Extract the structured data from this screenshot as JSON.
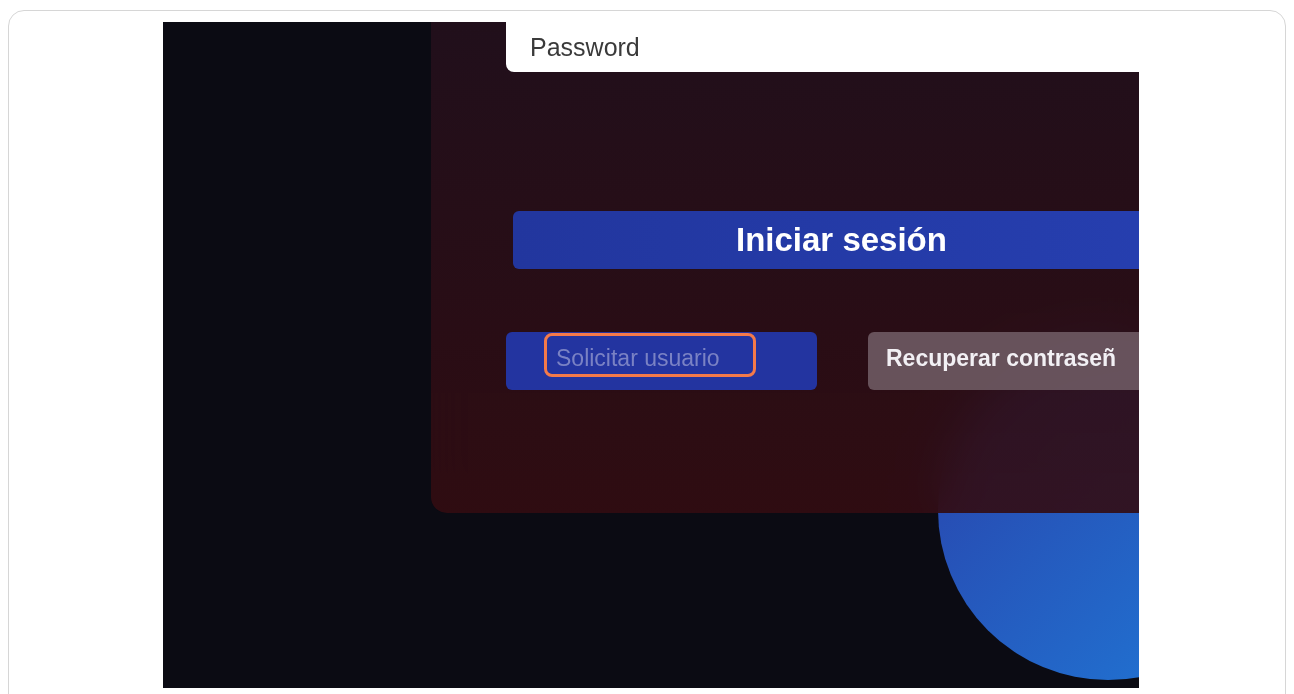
{
  "password_field": {
    "placeholder": "Password"
  },
  "login_button": {
    "label": "Iniciar sesión"
  },
  "secondary_buttons": [
    {
      "label": "Solicitar usuario",
      "kind": "primary",
      "highlighted": true
    },
    {
      "label": "Recuperar contraseñ",
      "kind": "muted",
      "highlighted": false
    }
  ]
}
